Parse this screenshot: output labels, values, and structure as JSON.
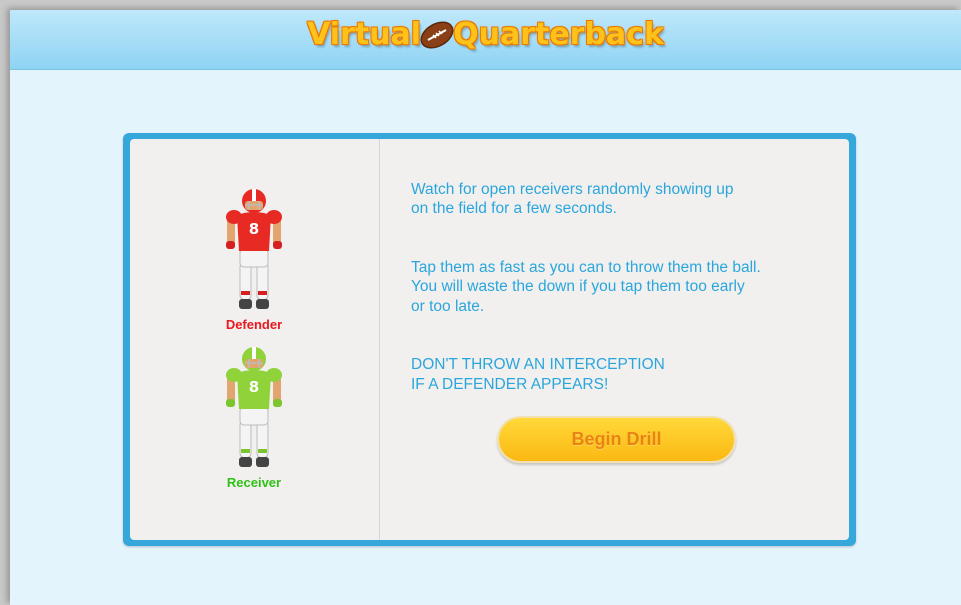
{
  "header": {
    "title_left": "Virtual",
    "title_right": "Quarterback",
    "icon": "football-icon"
  },
  "players": {
    "defender": {
      "label": "Defender",
      "jersey_number": "8",
      "color": "#e8181f"
    },
    "receiver": {
      "label": "Receiver",
      "jersey_number": "8",
      "color": "#2fc216"
    }
  },
  "instructions": {
    "p1": "Watch for open receivers randomly showing up\n on the field for a few seconds.",
    "p2": "Tap them as fast as you can to throw them the ball.\nYou will waste the down if you tap them too early\nor too late.",
    "p3": "DON'T THROW AN INTERCEPTION\nIF A DEFENDER APPEARS!"
  },
  "actions": {
    "begin_label": "Begin Drill"
  },
  "colors": {
    "accent": "#35a7da",
    "text": "#2aa6dc",
    "button": "#fbb812"
  }
}
